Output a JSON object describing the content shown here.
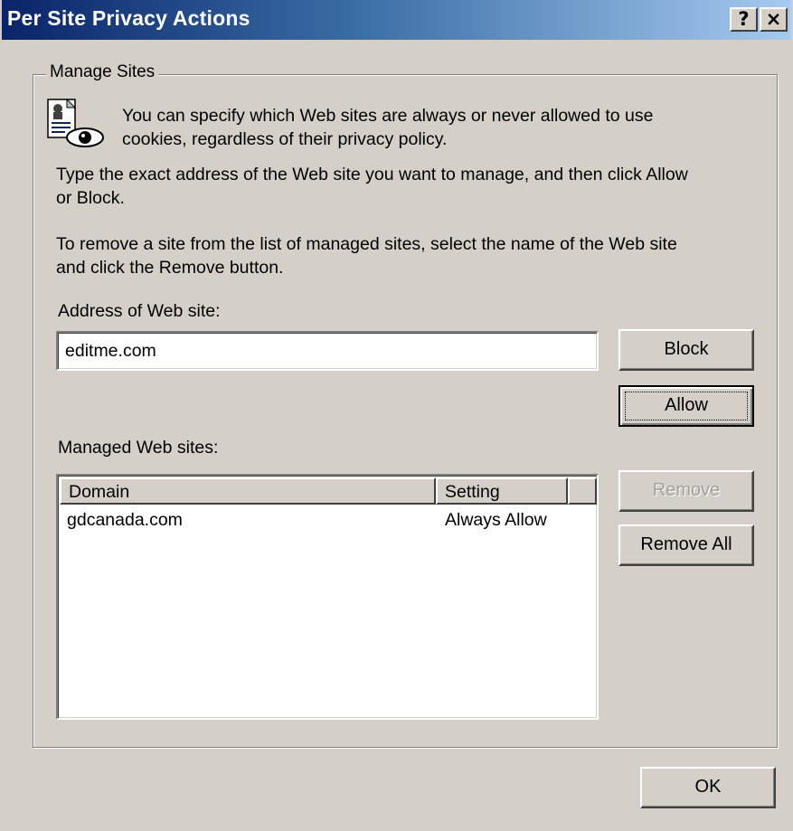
{
  "window": {
    "title": "Per Site Privacy Actions",
    "help_button": "?",
    "close_button": "×"
  },
  "manage_sites": {
    "legend": "Manage Sites",
    "intro_line1": "You can specify which Web sites are always or never allowed to use",
    "intro_line2": "cookies, regardless of their privacy policy.",
    "instruction_line1": "Type the exact address of the Web site you want to manage, and then click Allow",
    "instruction_line2": "or Block.",
    "remove_line1": "To remove a site from the list of managed sites, select the name of the Web site",
    "remove_line2": "and click the Remove button.",
    "address_label": "Address of Web site:",
    "address_value": "editme.com",
    "block_button": "Block",
    "allow_button": "Allow",
    "managed_label": "Managed Web sites:",
    "columns": {
      "domain": "Domain",
      "setting": "Setting"
    },
    "rows": [
      {
        "domain": "gdcanada.com",
        "setting": "Always Allow"
      }
    ],
    "remove_button": "Remove",
    "remove_all_button": "Remove All"
  },
  "ok_button": "OK",
  "icons": {
    "info": "privacy-document-eye-icon"
  },
  "colors": {
    "title_start": "#0a246a",
    "title_end": "#a6caf0",
    "dialog_face": "#d4d0c8"
  }
}
